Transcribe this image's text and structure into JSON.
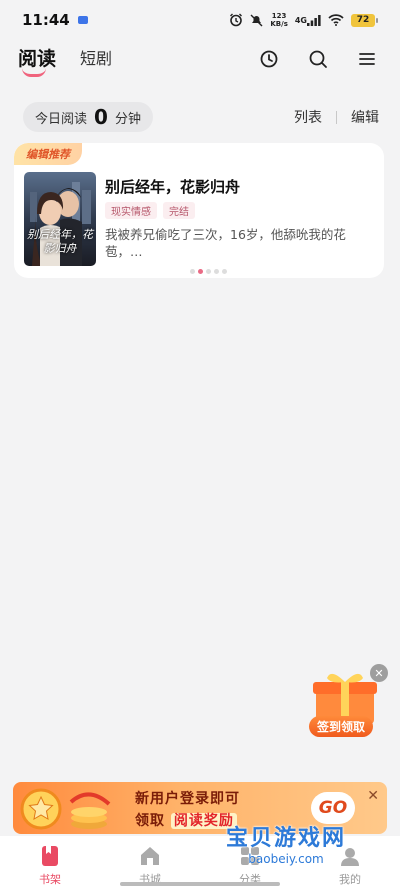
{
  "status_bar": {
    "time": "11:44",
    "net_speed_value": "123",
    "net_speed_unit": "KB/s",
    "network": "4G",
    "battery": "72"
  },
  "top_nav": {
    "tabs": [
      {
        "label": "阅读",
        "active": true
      },
      {
        "label": "短剧",
        "active": false
      }
    ],
    "icons": [
      "history-icon",
      "search-icon",
      "menu-icon"
    ]
  },
  "reading_time": {
    "prefix": "今日阅读",
    "minutes": "0",
    "suffix": "分钟"
  },
  "actions": {
    "list": "列表",
    "edit": "编辑"
  },
  "recommendation": {
    "badge": "编辑推荐",
    "book": {
      "title": "别后经年，花影归舟",
      "cover_text": "别后经年，花影归舟",
      "tags": [
        "现实情感",
        "完结"
      ],
      "description": "我被养兄偷吃了三次，16岁，他舔吮我的花苞，…"
    },
    "carousel_total": 5,
    "carousel_active": 1
  },
  "float_gift": {
    "label": "签到领取"
  },
  "promo": {
    "line1": "新用户登录即可",
    "line2_prefix": "领取",
    "line2_highlight": "阅读奖励",
    "go": "GO"
  },
  "watermark": {
    "text": "宝贝游戏网",
    "url": "baobeiy.com"
  },
  "bottom_nav": {
    "items": [
      {
        "label": "书架",
        "icon": "bookshelf-icon",
        "active": true
      },
      {
        "label": "书城",
        "icon": "store-home-icon",
        "active": false
      },
      {
        "label": "分类",
        "icon": "category-icon",
        "active": false
      },
      {
        "label": "我的",
        "icon": "profile-icon",
        "active": false
      }
    ]
  },
  "colors": {
    "accent": "#e94a63",
    "background": "#f3f3f4"
  }
}
